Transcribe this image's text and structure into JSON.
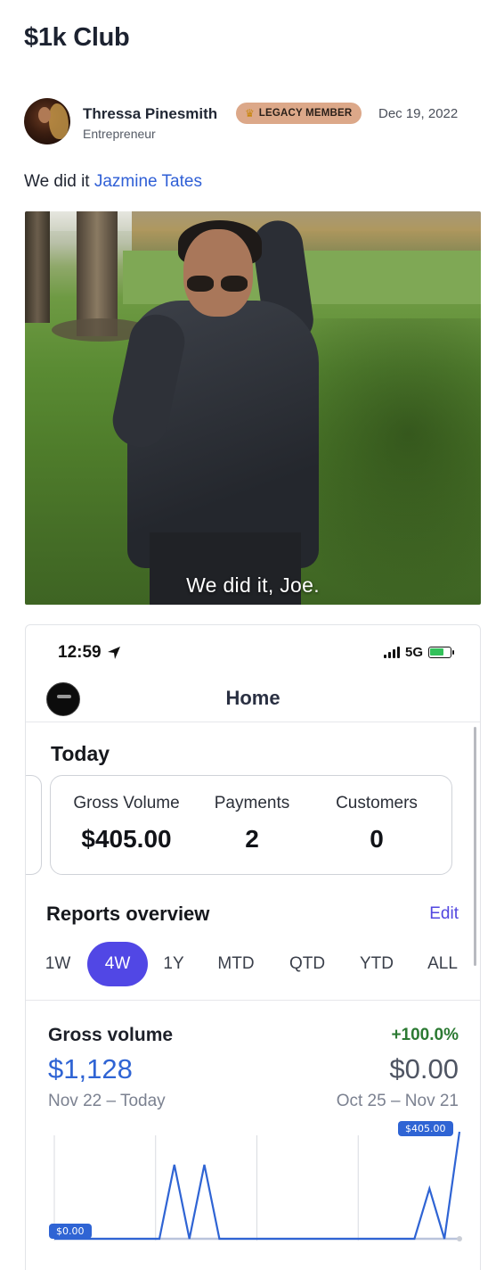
{
  "page": {
    "title": "$1k Club"
  },
  "post": {
    "author_name": "Thressa Pinesmith",
    "author_role": "Entrepreneur",
    "badge": "LEGACY MEMBER",
    "date": "Dec 19, 2022",
    "text_prefix": "We did it",
    "mention": "Jazmine Tates",
    "media_caption": "We did it, Joe."
  },
  "phone": {
    "status_time": "12:59",
    "network": "5G",
    "nav_title": "Home",
    "today_label": "Today",
    "metrics": [
      {
        "label": "Gross Volume",
        "value": "$405.00"
      },
      {
        "label": "Payments",
        "value": "2"
      },
      {
        "label": "Customers",
        "value": "0"
      }
    ],
    "reports_title": "Reports overview",
    "edit_label": "Edit",
    "tabs": [
      "1W",
      "4W",
      "1Y",
      "MTD",
      "QTD",
      "YTD",
      "ALL"
    ],
    "active_tab": "4W",
    "gross_volume": {
      "title": "Gross volume",
      "change": "+100.0%",
      "current": "$1,128",
      "previous": "$0.00",
      "current_range": "Nov 22 – Today",
      "previous_range": "Oct 25 – Nov 21",
      "min_label": "$0.00",
      "max_label": "$405.00"
    }
  },
  "colors": {
    "accent": "#5147e5",
    "link": "#2f5fd6",
    "chart_line": "#2f64d4",
    "positive": "#2c7a33",
    "badge_bg": "#dca889"
  },
  "chart_data": {
    "type": "line",
    "x": [
      1,
      2,
      3,
      4,
      5,
      6,
      7,
      8,
      9,
      10,
      11,
      12,
      13,
      14,
      15,
      16,
      17,
      18,
      19,
      20,
      21,
      22,
      23,
      24,
      25,
      26,
      27,
      28
    ],
    "series": [
      {
        "values": [
          0,
          0,
          0,
          0,
          0,
          0,
          0,
          0,
          0,
          0,
          0,
          0,
          0,
          0,
          0,
          0,
          0,
          0,
          0,
          0,
          0,
          0,
          0,
          0,
          0,
          0,
          0,
          0
        ]
      },
      {
        "values": [
          0,
          0,
          0,
          0,
          0,
          0,
          0,
          0,
          280,
          0,
          280,
          0,
          0,
          0,
          0,
          0,
          0,
          0,
          0,
          0,
          0,
          0,
          0,
          0,
          0,
          190,
          0,
          405
        ]
      }
    ],
    "ylim": [
      0,
      405
    ]
  }
}
